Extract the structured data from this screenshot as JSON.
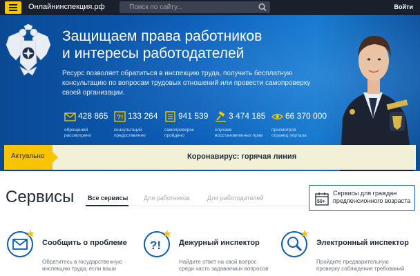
{
  "topbar": {
    "site_name": "Онлайнинспекция.рф",
    "search_placeholder": "Поиск по сайту...",
    "login_label": "Войти"
  },
  "hero": {
    "title_line1": "Защищаем права работников",
    "title_line2": "и интересы работодателей",
    "description": "Ресурс позволяет обратиться в инспекцию труда, получить бесплатную консультацию по вопросам трудовых отношений или провести самопроверку своей организации.",
    "stats": [
      {
        "icon": "envelope-icon",
        "value": "428 865",
        "label_line1": "обращений",
        "label_line2": "рассмотрено"
      },
      {
        "icon": "question-icon",
        "value": "133 264",
        "label_line1": "консультаций",
        "label_line2": "предоставлено"
      },
      {
        "icon": "checklist-icon",
        "value": "941 539",
        "label_line1": "самопроверок",
        "label_line2": "пройдено"
      },
      {
        "icon": "gavel-icon",
        "value": "3 474 185",
        "label_line1": "случаев",
        "label_line2": "восстановленных прав"
      },
      {
        "icon": "eye-icon",
        "value": "66 370 000",
        "label_line1": "просмотров",
        "label_line2": "страниц портала"
      }
    ]
  },
  "alert": {
    "tag": "Актуально",
    "text": "Коронавирус: горячая линия"
  },
  "services": {
    "title": "Сервисы",
    "tabs": [
      {
        "label": "Все сервисы",
        "active": true
      },
      {
        "label": "Для работников",
        "active": false
      },
      {
        "label": "Для работодателей",
        "active": false
      }
    ],
    "pension_button": {
      "badge": "50+",
      "label": "Сервисы для граждан предпенсионного возраста"
    },
    "cards": [
      {
        "icon": "envelope-icon",
        "title": "Сообщить о проблеме",
        "desc_line1": "Обратитесь в государственную",
        "desc_line2": "инспекцию труда, если ваши"
      },
      {
        "icon": "question-icon",
        "title": "Дежурный инспектор",
        "desc_line1": "Найдите ответ на свой вопрос",
        "desc_line2": "среди часто задаваемых вопросов"
      },
      {
        "icon": "magnifier-icon",
        "title": "Электронный инспектор",
        "desc_line1": "Пройдите предварительную",
        "desc_line2": "проверку соблюдения требований"
      }
    ]
  },
  "colors": {
    "accent": "#f6c400",
    "primary_blue": "#0b5cb6",
    "topbar": "#1a1f2c",
    "text_dark": "#1e2a3a"
  }
}
